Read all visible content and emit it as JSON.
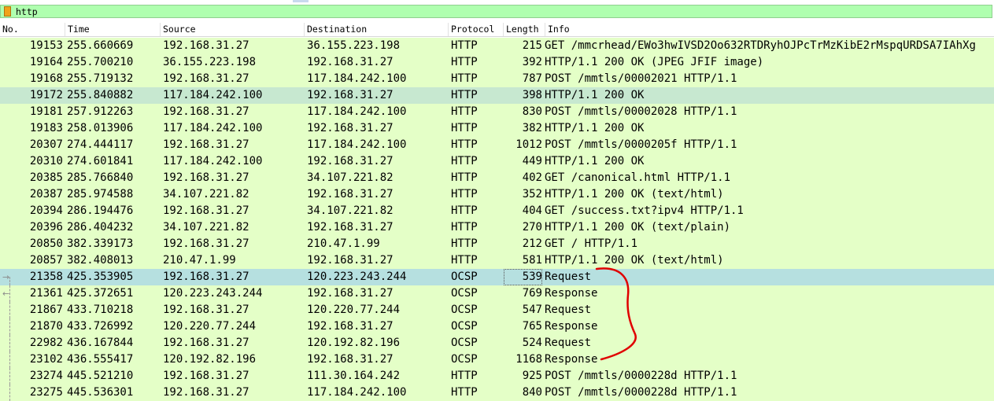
{
  "filter": {
    "value": "http"
  },
  "columns": {
    "no": "No.",
    "time": "Time",
    "source": "Source",
    "destination": "Destination",
    "protocol": "Protocol",
    "length": "Length",
    "info": "Info"
  },
  "packets": [
    {
      "no": "19153",
      "time": "255.660669",
      "src": "192.168.31.27",
      "dst": "36.155.223.198",
      "proto": "HTTP",
      "len": "215",
      "info": "GET /mmcrhead/EWo3hwIVSD2Oo632RTDRyhOJPcTrMzKibE2rMspqURDSA7IAhXg"
    },
    {
      "no": "19164",
      "time": "255.700210",
      "src": "36.155.223.198",
      "dst": "192.168.31.27",
      "proto": "HTTP",
      "len": "392",
      "info": "HTTP/1.1 200 OK  (JPEG JFIF image)"
    },
    {
      "no": "19168",
      "time": "255.719132",
      "src": "192.168.31.27",
      "dst": "117.184.242.100",
      "proto": "HTTP",
      "len": "787",
      "info": "POST /mmtls/00002021 HTTP/1.1"
    },
    {
      "no": "19172",
      "time": "255.840882",
      "src": "117.184.242.100",
      "dst": "192.168.31.27",
      "proto": "HTTP",
      "len": "398",
      "info": "HTTP/1.1 200 OK"
    },
    {
      "no": "19181",
      "time": "257.912263",
      "src": "192.168.31.27",
      "dst": "117.184.242.100",
      "proto": "HTTP",
      "len": "830",
      "info": "POST /mmtls/00002028 HTTP/1.1"
    },
    {
      "no": "19183",
      "time": "258.013906",
      "src": "117.184.242.100",
      "dst": "192.168.31.27",
      "proto": "HTTP",
      "len": "382",
      "info": "HTTP/1.1 200 OK"
    },
    {
      "no": "20307",
      "time": "274.444117",
      "src": "192.168.31.27",
      "dst": "117.184.242.100",
      "proto": "HTTP",
      "len": "1012",
      "info": "POST /mmtls/0000205f HTTP/1.1"
    },
    {
      "no": "20310",
      "time": "274.601841",
      "src": "117.184.242.100",
      "dst": "192.168.31.27",
      "proto": "HTTP",
      "len": "449",
      "info": "HTTP/1.1 200 OK"
    },
    {
      "no": "20385",
      "time": "285.766840",
      "src": "192.168.31.27",
      "dst": "34.107.221.82",
      "proto": "HTTP",
      "len": "402",
      "info": "GET /canonical.html HTTP/1.1"
    },
    {
      "no": "20387",
      "time": "285.974588",
      "src": "34.107.221.82",
      "dst": "192.168.31.27",
      "proto": "HTTP",
      "len": "352",
      "info": "HTTP/1.1 200 OK  (text/html)"
    },
    {
      "no": "20394",
      "time": "286.194476",
      "src": "192.168.31.27",
      "dst": "34.107.221.82",
      "proto": "HTTP",
      "len": "404",
      "info": "GET /success.txt?ipv4 HTTP/1.1"
    },
    {
      "no": "20396",
      "time": "286.404232",
      "src": "34.107.221.82",
      "dst": "192.168.31.27",
      "proto": "HTTP",
      "len": "270",
      "info": "HTTP/1.1 200 OK  (text/plain)"
    },
    {
      "no": "20850",
      "time": "382.339173",
      "src": "192.168.31.27",
      "dst": "210.47.1.99",
      "proto": "HTTP",
      "len": "212",
      "info": "GET / HTTP/1.1"
    },
    {
      "no": "20857",
      "time": "382.408013",
      "src": "210.47.1.99",
      "dst": "192.168.31.27",
      "proto": "HTTP",
      "len": "581",
      "info": "HTTP/1.1 200 OK  (text/html)"
    },
    {
      "no": "21358",
      "time": "425.353905",
      "src": "192.168.31.27",
      "dst": "120.223.243.244",
      "proto": "OCSP",
      "len": "539",
      "info": "Request"
    },
    {
      "no": "21361",
      "time": "425.372651",
      "src": "120.223.243.244",
      "dst": "192.168.31.27",
      "proto": "OCSP",
      "len": "769",
      "info": "Response"
    },
    {
      "no": "21867",
      "time": "433.710218",
      "src": "192.168.31.27",
      "dst": "120.220.77.244",
      "proto": "OCSP",
      "len": "547",
      "info": "Request"
    },
    {
      "no": "21870",
      "time": "433.726992",
      "src": "120.220.77.244",
      "dst": "192.168.31.27",
      "proto": "OCSP",
      "len": "765",
      "info": "Response"
    },
    {
      "no": "22982",
      "time": "436.167844",
      "src": "192.168.31.27",
      "dst": "120.192.82.196",
      "proto": "OCSP",
      "len": "524",
      "info": "Request"
    },
    {
      "no": "23102",
      "time": "436.555417",
      "src": "120.192.82.196",
      "dst": "192.168.31.27",
      "proto": "OCSP",
      "len": "1168",
      "info": "Response"
    },
    {
      "no": "23274",
      "time": "445.521210",
      "src": "192.168.31.27",
      "dst": "111.30.164.242",
      "proto": "HTTP",
      "len": "925",
      "info": "POST /mmtls/0000228d HTTP/1.1"
    },
    {
      "no": "23275",
      "time": "445.536301",
      "src": "192.168.31.27",
      "dst": "117.184.242.100",
      "proto": "HTTP",
      "len": "840",
      "info": "POST /mmtls/0000228d HTTP/1.1"
    }
  ],
  "colors": {
    "row_bg": "#e4ffc7",
    "hover_row_bg": "#c7e8d0",
    "selected_row_bg": "#b6e0e0",
    "filter_bg": "#afffaf",
    "annotation": "#e00000"
  },
  "icons": {
    "filter_bookmark": "bookmark-icon",
    "request_arrow": "arrow-right-icon",
    "response_arrow": "arrow-left-icon"
  }
}
